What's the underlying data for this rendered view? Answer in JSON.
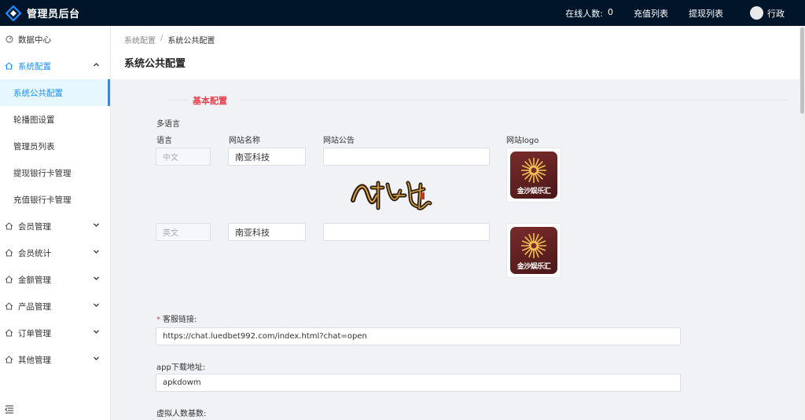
{
  "header": {
    "title": "管理员后台",
    "online_label": "在线人数:",
    "online_count": "0",
    "recharge_list": "充值列表",
    "withdraw_list": "提现列表",
    "user_name": "行政"
  },
  "sidebar": {
    "items": [
      {
        "label": "数据中心",
        "icon": "dashboard-icon"
      },
      {
        "label": "系统配置",
        "icon": "settings-icon",
        "open": true
      },
      {
        "label": "会员管理",
        "icon": "home-icon"
      },
      {
        "label": "会员统计",
        "icon": "home-icon"
      },
      {
        "label": "金额管理",
        "icon": "home-icon"
      },
      {
        "label": "产品管理",
        "icon": "home-icon"
      },
      {
        "label": "订单管理",
        "icon": "home-icon"
      },
      {
        "label": "其他管理",
        "icon": "home-icon"
      }
    ],
    "sub_items": [
      {
        "label": "系统公共配置",
        "active": true
      },
      {
        "label": "轮播图设置"
      },
      {
        "label": "管理员列表"
      },
      {
        "label": "提现银行卡管理"
      },
      {
        "label": "充值银行卡管理"
      }
    ]
  },
  "breadcrumb": {
    "parent": "系统配置",
    "separator": "/",
    "current": "系统公共配置"
  },
  "page": {
    "title": "系统公共配置"
  },
  "form": {
    "section_title": "基本配置",
    "multi_language_label": "多语言",
    "col_language": "语言",
    "col_site_name": "网站名称",
    "col_notice": "网站公告",
    "col_logo": "网站logo",
    "rows": [
      {
        "language": "中文",
        "site_name": "南亚科技",
        "notice": "",
        "logo_text": "金沙娱乐汇"
      },
      {
        "language": "英文",
        "site_name": "南亚科技",
        "notice": "",
        "logo_text": "金沙娱乐汇"
      }
    ],
    "customer_service_label": "客服链接:",
    "customer_service_value": "https://chat.luedbet992.com/index.html?chat=open",
    "app_download_label": "app下载地址:",
    "app_download_value": "apkdowm",
    "virtual_count_label": "虚拟人数基数:"
  },
  "colors": {
    "header_bg": "#001529",
    "accent": "#1890ff",
    "section_title": "#e6404b"
  }
}
